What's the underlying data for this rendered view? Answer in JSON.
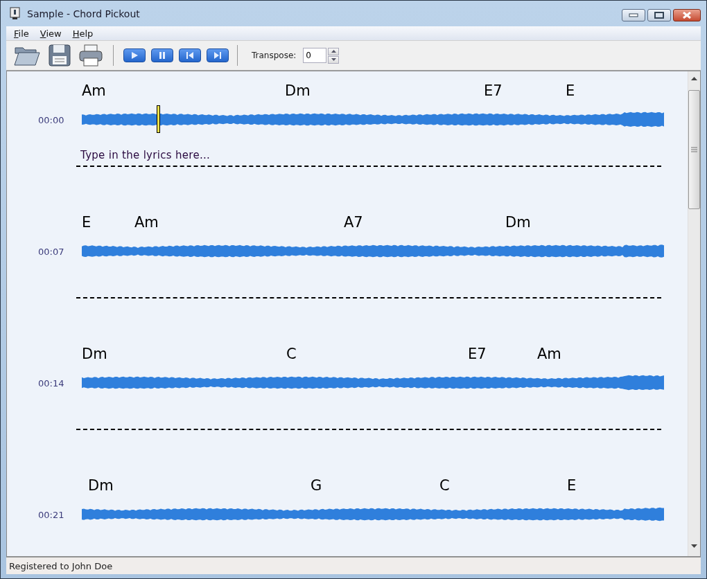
{
  "window": {
    "title": "Sample - Chord Pickout"
  },
  "menu": [
    {
      "label": "File"
    },
    {
      "label": "View"
    },
    {
      "label": "Help"
    }
  ],
  "toolbar": {
    "transpose": {
      "label": "Transpose:",
      "value": "0"
    }
  },
  "rows": [
    {
      "time": "00:00",
      "chords": [
        "Am",
        "Dm",
        "E7",
        "E"
      ],
      "placeholder": "Type in the lyrics here...",
      "playhead": true
    },
    {
      "time": "00:07",
      "chords": [
        "E",
        "Am",
        "A7",
        "Dm"
      ],
      "playhead": false
    },
    {
      "time": "00:14",
      "chords": [
        "Dm",
        "C",
        "E7",
        "Am"
      ],
      "playhead": false
    },
    {
      "time": "00:21",
      "chords": [
        "Dm",
        "G",
        "C",
        "E"
      ],
      "playhead": false
    }
  ],
  "status_bar": "Registered to John Doe"
}
